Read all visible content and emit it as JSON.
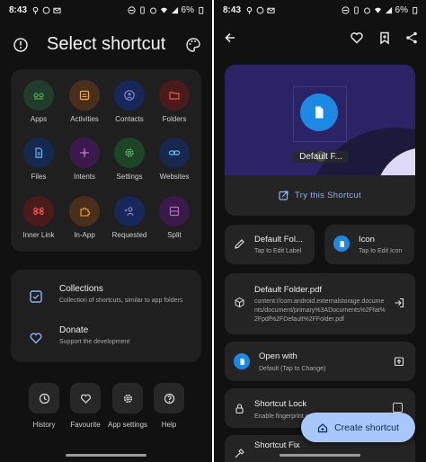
{
  "status_bar": {
    "time": "8:43",
    "battery": "6%"
  },
  "left_screen": {
    "title": "Select shortcut",
    "header_icons": [
      "info-icon",
      "palette-icon"
    ],
    "grid": [
      {
        "label": "Apps",
        "icon": "apps-icon",
        "color": "#1f3d2a"
      },
      {
        "label": "Activities",
        "icon": "activities-icon",
        "color": "#4a2e1c"
      },
      {
        "label": "Contacts",
        "icon": "contacts-icon",
        "color": "#18275a"
      },
      {
        "label": "Folders",
        "icon": "folder-icon",
        "color": "#4b1b1b"
      },
      {
        "label": "Files",
        "icon": "file-icon",
        "color": "#17284f"
      },
      {
        "label": "Intents",
        "icon": "intents-icon",
        "color": "#3a1a4a"
      },
      {
        "label": "Settings",
        "icon": "settings-icon",
        "color": "#1d4424"
      },
      {
        "label": "Websites",
        "icon": "link-icon",
        "color": "#17284f"
      },
      {
        "label": "Inner Link",
        "icon": "command-icon",
        "color": "#4b1b1b"
      },
      {
        "label": "In-App",
        "icon": "puzzle-icon",
        "color": "#4a2e1c"
      },
      {
        "label": "Requested",
        "icon": "person-add-icon",
        "color": "#18275a"
      },
      {
        "label": "Split",
        "icon": "split-icon",
        "color": "#3a1a4a"
      }
    ],
    "info": [
      {
        "title": "Collections",
        "subtitle": "Collection of shortcuts, similar to app folders"
      },
      {
        "title": "Donate",
        "subtitle": "Support the development"
      }
    ],
    "nav": [
      {
        "label": "History",
        "icon": "history-icon"
      },
      {
        "label": "Favourite",
        "icon": "heart-icon"
      },
      {
        "label": "App settings",
        "icon": "gear-icon"
      },
      {
        "label": "Help",
        "icon": "help-icon"
      }
    ]
  },
  "right_screen": {
    "preview_name": "Default F...",
    "try_label": "Try this Shortcut",
    "label_card": {
      "title": "Default Fol...",
      "subtitle": "Tap to Edit Label"
    },
    "icon_card": {
      "title": "Icon",
      "subtitle": "Tap to Edit Icon"
    },
    "uri_card": {
      "title": "Default Folder.pdf",
      "subtitle": "content://com.android.externalstorage.documents/document/primary%3ADocuments%2Ffat%2Fpdf%2FDefault%2FFolder.pdf"
    },
    "open_with": {
      "title": "Open with",
      "subtitle": "Default (Tap to Change)"
    },
    "shortcut_lock": {
      "title": "Shortcut Lock",
      "subtitle": "Enable fingerprint or"
    },
    "shortcut_fix": {
      "title": "Shortcut Fix"
    },
    "fab_label": "Create shortcut"
  },
  "colors": {
    "accent_blue": "#1e88e5",
    "fab": "#a8c7fa",
    "link": "#8ab4f8"
  }
}
